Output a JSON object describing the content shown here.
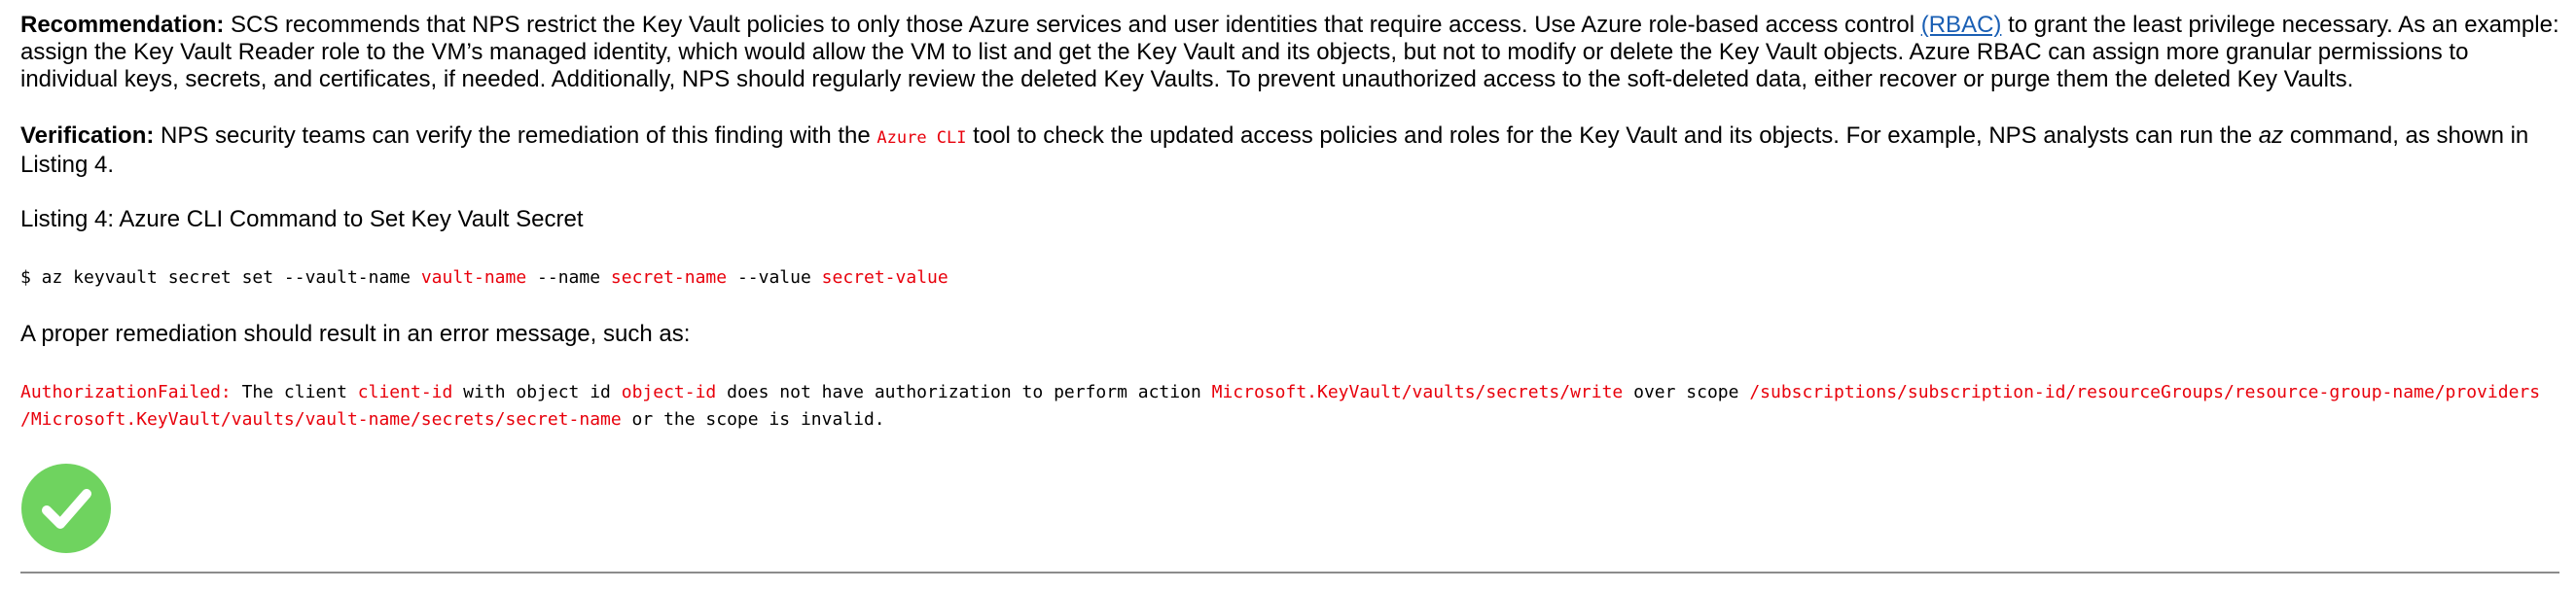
{
  "recommendation": {
    "label": "Recommendation:",
    "text1": " SCS recommends that NPS restrict the Key Vault policies to only those Azure services and user identities that require access. Use Azure role-based access control ",
    "link": "(RBAC)",
    "text2": " to grant the least privilege necessary. As an example: assign the Key Vault Reader role to the VM’s managed identity, which would allow the VM to list and get the Key Vault and its objects, but not to modify or delete the Key Vault objects. Azure RBAC can assign more granular permissions to individual keys, secrets, and certificates, if needed. Additionally, NPS should regularly review the deleted Key Vaults. To prevent unauthorized access to the soft-deleted data, either recover or purge them the deleted Key Vaults."
  },
  "verification": {
    "label": "Verification:",
    "text1": " NPS security teams can verify the remediation of this finding with the ",
    "tool": "Azure CLI",
    "text2": " tool to check the updated access policies and roles for the Key Vault and its objects. For example, NPS analysts can run the ",
    "cmd": "az",
    "text3": " command, as shown in Listing 4."
  },
  "listing_title": "Listing 4: Azure CLI Command to Set Key Vault Secret",
  "command": {
    "prefix": "$ az keyvault secret set --vault-name ",
    "vault": "vault-name",
    "mid1": " --name ",
    "secret": "secret-name",
    "mid2": " --value ",
    "value": "secret-value"
  },
  "proper_text": "A proper remediation should result in an error message, such as:",
  "error": {
    "code": "AuthorizationFailed:",
    "t1": " The client ",
    "client": "client-id",
    "t2": " with object id ",
    "object": "object-id",
    "t3": " does not have authorization to perform action ",
    "action": "Microsoft.KeyVault/vaults/secrets/write",
    "t4": " over scope ",
    "scope1": "/subscriptions/subscription-id/resourceGroups/resource-group-name/providers",
    "scope2": "/Microsoft.KeyVault/vaults/vault-name/secrets/secret-name",
    "t5": " or the scope is invalid."
  },
  "colors": {
    "code_red": "#e8000b",
    "link_blue": "#1a5fb4",
    "check_green": "#6fd35f"
  },
  "icons": {
    "status": "check-circle-icon"
  }
}
